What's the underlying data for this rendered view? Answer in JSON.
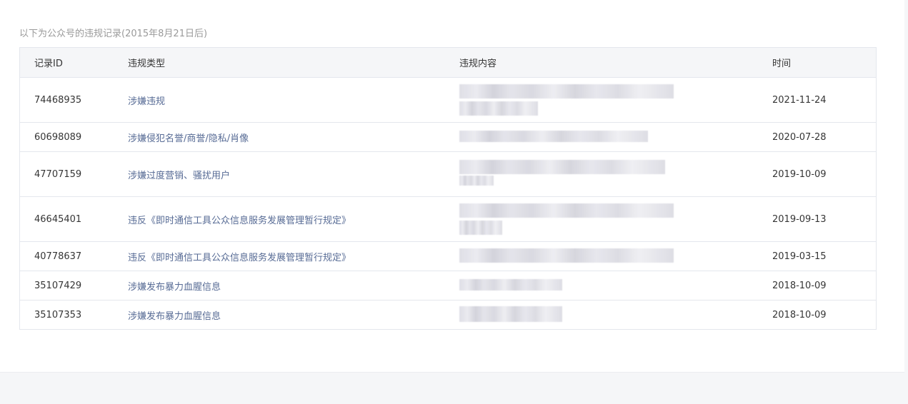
{
  "intro_text": "以下为公众号的违规记录(2015年8月21日后)",
  "table": {
    "headers": {
      "id": "记录ID",
      "type": "违规类型",
      "content": "违规内容",
      "time": "时间"
    },
    "rows": [
      {
        "id": "74468935",
        "type": "涉嫌违规",
        "time": "2021-11-24"
      },
      {
        "id": "60698089",
        "type": "涉嫌侵犯名誉/商誉/隐私/肖像",
        "time": "2020-07-28"
      },
      {
        "id": "47707159",
        "type": "涉嫌过度营销、骚扰用户",
        "time": "2019-10-09"
      },
      {
        "id": "46645401",
        "type": "违反《即时通信工具公众信息服务发展管理暂行规定》",
        "time": "2019-09-13"
      },
      {
        "id": "40778637",
        "type": "违反《即时通信工具公众信息服务发展管理暂行规定》",
        "time": "2019-03-15"
      },
      {
        "id": "35107429",
        "type": "涉嫌发布暴力血腥信息",
        "time": "2018-10-09"
      },
      {
        "id": "35107353",
        "type": "涉嫌发布暴力血腥信息",
        "time": "2018-10-09"
      }
    ]
  },
  "colors": {
    "link_blue": "#576b95",
    "header_bg": "#f5f6f8",
    "border": "#e4e7ed",
    "muted": "#9a9a9a"
  }
}
